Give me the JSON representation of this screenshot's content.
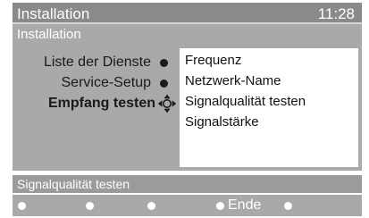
{
  "header": {
    "title": "Installation",
    "clock": "11:28"
  },
  "subheader": {
    "title": "Installation"
  },
  "left_menu": {
    "items": [
      {
        "label": "Liste der Dienste"
      },
      {
        "label": "Service-Setup"
      },
      {
        "label": "Empfang testen"
      }
    ],
    "selected": "Empfang testen"
  },
  "right_menu": {
    "options": [
      {
        "label": "Frequenz"
      },
      {
        "label": "Netzwerk-Name"
      },
      {
        "label": "Signalqualität testen"
      },
      {
        "label": "Signalstärke"
      }
    ]
  },
  "status": {
    "text": "Signalqualität testen"
  },
  "bottom_bar": {
    "ende_label": "Ende"
  },
  "icons": {
    "bullet": "filled-dot-icon",
    "navigation": "navigation-cross-icon"
  },
  "colors": {
    "header_bg": "#8a8a8a",
    "panel_bg": "#a9a9a9",
    "list_bg": "#ffffff",
    "text_dark": "#1a1a1a",
    "text_light": "#ffffff"
  }
}
